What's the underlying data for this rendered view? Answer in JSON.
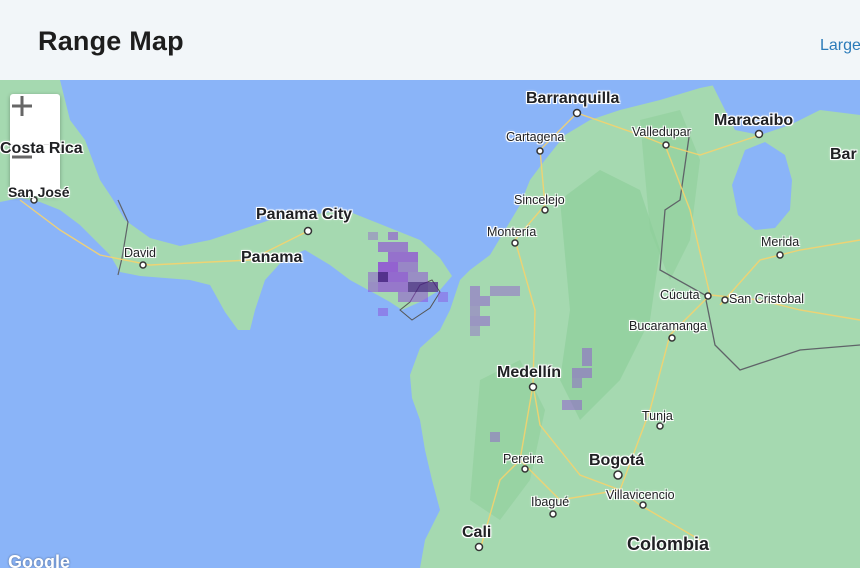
{
  "header": {
    "title": "Range Map",
    "link_label": "Large"
  },
  "map": {
    "zoom_in_label": "+",
    "zoom_out_label": "−",
    "attribution": "Google",
    "range_color": "#8e44d8",
    "range_dark_color": "#4b1f8a",
    "cities": {
      "barranquilla": "Barranquilla",
      "cartagena": "Cartagena",
      "valledupar": "Valledupar",
      "maracaibo": "Maracaibo",
      "barquisimeto": "Bar",
      "sincelejo": "Sincelejo",
      "monteria": "Montería",
      "merida": "Merida",
      "cucuta": "Cúcuta",
      "san_cristobal": "San Cristobal",
      "bucaramanga": "Bucaramanga",
      "medellin": "Medellín",
      "tunja": "Tunja",
      "pereira": "Pereira",
      "bogota": "Bogotá",
      "ibague": "Ibagué",
      "villavicencio": "Villavicencio",
      "cali": "Cali",
      "panama_city": "Panama City",
      "david": "David",
      "san_jose": "San José",
      "costa_rica": "Costa Rica"
    },
    "countries": {
      "panama": "Panama",
      "colombia": "Colombia"
    }
  }
}
